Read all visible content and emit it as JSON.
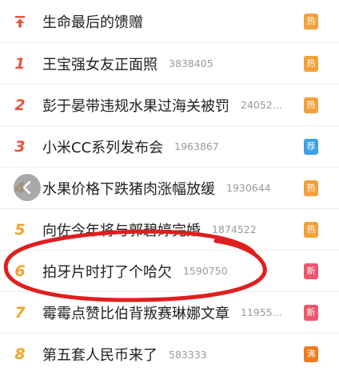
{
  "colors": {
    "rank_red": "#e8543a",
    "rank_orange": "#f3a32a",
    "badge_hot": "#f2a13a",
    "badge_new": "#f2546a",
    "badge_recommend": "#3ea0ea",
    "badge_boil": "#f07b1f",
    "annotation": "#e01e1e"
  },
  "items": [
    {
      "rank": "",
      "icon": "pin-top-icon",
      "title": "生命最后的馈赠",
      "count": "",
      "badge": "热",
      "badge_type": "hot"
    },
    {
      "rank": "1",
      "title": "王宝强女友正面照",
      "count": "3838405",
      "badge": "热",
      "badge_type": "hot"
    },
    {
      "rank": "2",
      "title": "彭于晏带违规水果过海关被罚",
      "count": "24052...",
      "badge": "热",
      "badge_type": "hot"
    },
    {
      "rank": "3",
      "title": "小米CC系列发布会",
      "count": "1963867",
      "badge": "荐",
      "badge_type": "recommend"
    },
    {
      "rank": "4",
      "title": "水果价格下跌猪肉涨幅放缓",
      "count": "1930644",
      "badge": "热",
      "badge_type": "hot"
    },
    {
      "rank": "5",
      "title": "向佐今年将与郭碧婷完婚",
      "count": "1874522",
      "badge": "热",
      "badge_type": "hot"
    },
    {
      "rank": "6",
      "title": "拍牙片时打了个哈欠",
      "count": "1590750",
      "badge": "新",
      "badge_type": "new"
    },
    {
      "rank": "7",
      "title": "霉霉点赞比伯背叛赛琳娜文章",
      "count": "11955...",
      "badge": "新",
      "badge_type": "new"
    },
    {
      "rank": "8",
      "title": "第五套人民币来了",
      "count": "583333",
      "badge": "沸",
      "badge_type": "boil"
    }
  ]
}
